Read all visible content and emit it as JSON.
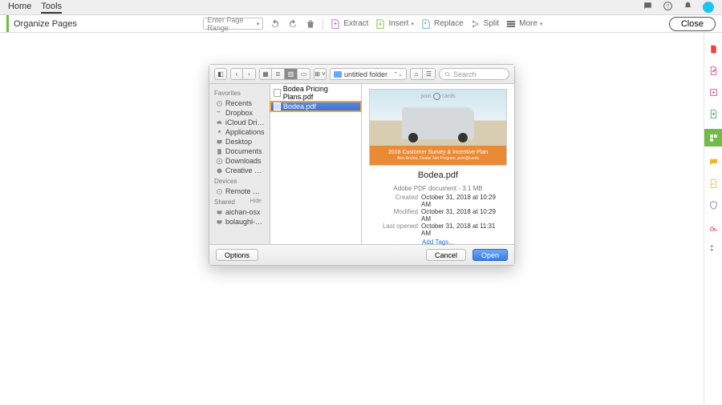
{
  "topbar": {
    "tabs": [
      "Home",
      "Tools"
    ],
    "activeTab": 1,
    "icons": [
      "chat-icon",
      "help-icon",
      "bell-icon",
      "avatar"
    ]
  },
  "subbar": {
    "title": "Organize Pages",
    "rangePlaceholder": "Enter Page Range",
    "tools": {
      "extract": "Extract",
      "insert": "Insert",
      "replace": "Replace",
      "split": "Split",
      "more": "More"
    },
    "close": "Close"
  },
  "rail": {
    "items": [
      "pdf-icon",
      "edit-pdf-icon",
      "create-pdf-icon",
      "export-pdf-icon",
      "organize-icon",
      "send-sign-icon",
      "comment-icon",
      "fill-sign-icon",
      "protect-icon",
      "enhance-icon",
      "more-tools-icon"
    ],
    "activeIndex": 4
  },
  "dialog": {
    "folder": "untitled folder",
    "searchPlaceholder": "Search",
    "sidebar": {
      "sections": [
        {
          "label": "Favorites",
          "items": [
            "Recents",
            "Dropbox",
            "iCloud Drive",
            "Applications",
            "Desktop",
            "Documents",
            "Downloads",
            "Creative Cloud..."
          ]
        },
        {
          "label": "Devices",
          "items": [
            "Remote Disc"
          ]
        },
        {
          "label": "Shared",
          "hide": "Hide",
          "items": [
            "aichan-osx",
            "bolaughl-mac..."
          ]
        }
      ]
    },
    "files": [
      {
        "name": "Bodea Pricing Plans.pdf",
        "selected": false
      },
      {
        "name": "Bodea.pdf",
        "selected": true
      }
    ],
    "preview": {
      "brandLeft": "poin",
      "brandRight": "cards",
      "bannerTitle": "2018 Customer Survey & Incentive Plan",
      "bannerSub": "Alex Bodea, Dealer Net Program, poin@cards",
      "filename": "Bodea.pdf",
      "kind": "Adobe PDF document - 3.1 MB",
      "created": {
        "k": "Created",
        "v": "October 31, 2018 at 10:29 AM"
      },
      "modified": {
        "k": "Modified",
        "v": "October 31, 2018 at 10:29 AM"
      },
      "lastOpened": {
        "k": "Last opened",
        "v": "October 31, 2018 at 11:31 AM"
      },
      "addTags": "Add Tags..."
    },
    "footer": {
      "options": "Options",
      "cancel": "Cancel",
      "open": "Open"
    }
  }
}
